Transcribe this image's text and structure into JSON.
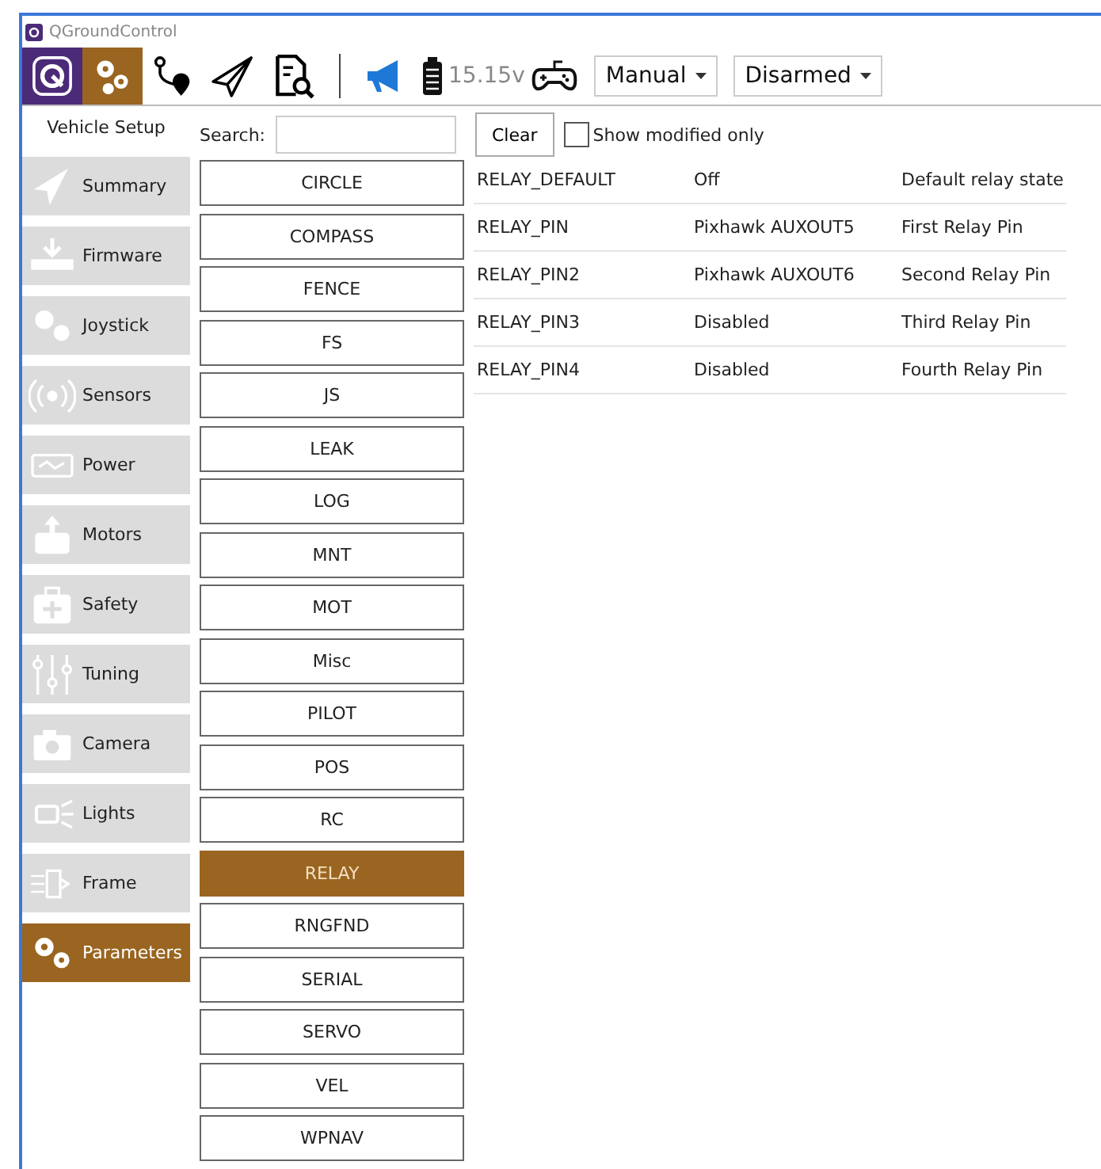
{
  "window": {
    "title": "QGroundControl"
  },
  "toolbar": {
    "views": [
      {
        "kind": "logo",
        "selected": false
      },
      {
        "kind": "setup",
        "selected": true
      },
      {
        "kind": "plan",
        "selected": false
      },
      {
        "kind": "fly",
        "selected": false
      },
      {
        "kind": "analyze",
        "selected": false
      }
    ],
    "battery": "15.15v",
    "flight_mode": "Manual",
    "arm_state": "Disarmed"
  },
  "sidebar": {
    "title": "Vehicle Setup",
    "items": [
      {
        "label": "Summary",
        "selected": false
      },
      {
        "label": "Firmware",
        "selected": false
      },
      {
        "label": "Joystick",
        "selected": false
      },
      {
        "label": "Sensors",
        "selected": false
      },
      {
        "label": "Power",
        "selected": false
      },
      {
        "label": "Motors",
        "selected": false
      },
      {
        "label": "Safety",
        "selected": false
      },
      {
        "label": "Tuning",
        "selected": false
      },
      {
        "label": "Camera",
        "selected": false
      },
      {
        "label": "Lights",
        "selected": false
      },
      {
        "label": "Frame",
        "selected": false
      },
      {
        "label": "Parameters",
        "selected": true
      }
    ]
  },
  "search": {
    "label": "Search:",
    "clear": "Clear",
    "modified_only": {
      "label": "Show modified only",
      "checked": false
    }
  },
  "groups": [
    {
      "label": "CIRCLE",
      "selected": false
    },
    {
      "label": "COMPASS",
      "selected": false
    },
    {
      "label": "FENCE",
      "selected": false
    },
    {
      "label": "FS",
      "selected": false
    },
    {
      "label": "JS",
      "selected": false
    },
    {
      "label": "LEAK",
      "selected": false
    },
    {
      "label": "LOG",
      "selected": false
    },
    {
      "label": "MNT",
      "selected": false
    },
    {
      "label": "MOT",
      "selected": false
    },
    {
      "label": "Misc",
      "selected": false
    },
    {
      "label": "PILOT",
      "selected": false
    },
    {
      "label": "POS",
      "selected": false
    },
    {
      "label": "RC",
      "selected": false
    },
    {
      "label": "RELAY",
      "selected": true
    },
    {
      "label": "RNGFND",
      "selected": false
    },
    {
      "label": "SERIAL",
      "selected": false
    },
    {
      "label": "SERVO",
      "selected": false
    },
    {
      "label": "VEL",
      "selected": false
    },
    {
      "label": "WPNAV",
      "selected": false
    }
  ],
  "table": {
    "rows": [
      {
        "name": "RELAY_DEFAULT",
        "value": "Off",
        "description": "Default relay state"
      },
      {
        "name": "RELAY_PIN",
        "value": "Pixhawk AUXOUT5",
        "description": "First Relay Pin"
      },
      {
        "name": "RELAY_PIN2",
        "value": "Pixhawk AUXOUT6",
        "description": "Second Relay Pin"
      },
      {
        "name": "RELAY_PIN3",
        "value": "Disabled",
        "description": "Third Relay Pin"
      },
      {
        "name": "RELAY_PIN4",
        "value": "Disabled",
        "description": "Fourth Relay Pin"
      }
    ]
  }
}
